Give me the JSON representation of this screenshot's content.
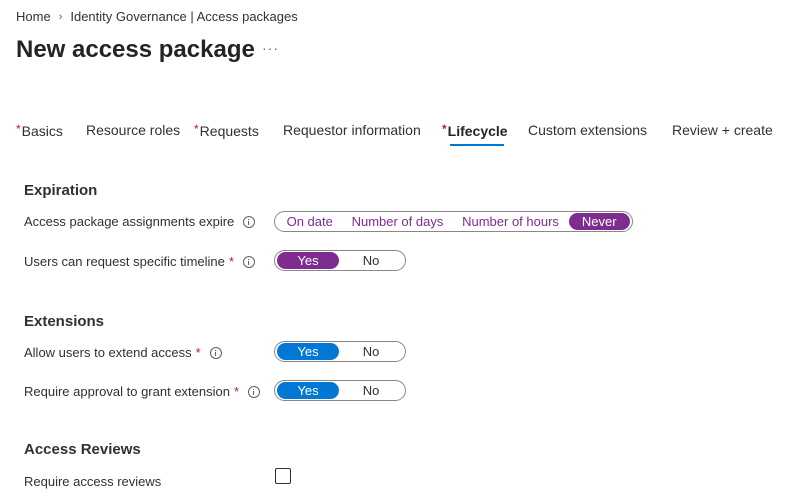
{
  "breadcrumb": {
    "home": "Home",
    "separator": "›",
    "current": "Identity Governance | Access packages"
  },
  "page": {
    "title": "New access package",
    "more": "···"
  },
  "tabs": [
    {
      "label": "Basics",
      "required": true
    },
    {
      "label": "Resource roles",
      "required": false
    },
    {
      "label": "Requests",
      "required": true
    },
    {
      "label": "Requestor information",
      "required": false
    },
    {
      "label": "Lifecycle",
      "required": true,
      "active": true
    },
    {
      "label": "Custom extensions",
      "required": false
    },
    {
      "label": "Review + create",
      "required": false
    }
  ],
  "required_marker": "*",
  "expiration": {
    "title": "Expiration",
    "assignments_expire": {
      "label": "Access package assignments expire",
      "options": [
        "On date",
        "Number of days",
        "Number of hours",
        "Never"
      ],
      "selected": "Never"
    },
    "specific_timeline": {
      "label": "Users can request specific timeline",
      "options": [
        "Yes",
        "No"
      ],
      "selected": "Yes"
    }
  },
  "extensions": {
    "title": "Extensions",
    "extend_access": {
      "label": "Allow users to extend access",
      "options": [
        "Yes",
        "No"
      ],
      "selected": "Yes"
    },
    "approval_extension": {
      "label": "Require approval to grant extension",
      "options": [
        "Yes",
        "No"
      ],
      "selected": "Yes"
    }
  },
  "access_reviews": {
    "title": "Access Reviews",
    "require_reviews": {
      "label": "Require access reviews",
      "checked": false
    }
  },
  "colors": {
    "accent_blue": "#0078d4",
    "accent_purple": "#7e2c8f",
    "required_red": "#a4262c"
  }
}
